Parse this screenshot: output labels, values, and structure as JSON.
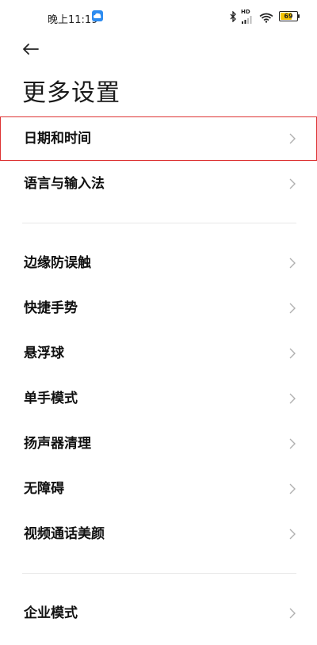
{
  "status_bar": {
    "time": "晚上11:19",
    "battery": "69",
    "battery_level": 0.69,
    "network_label": "HD",
    "icons": [
      "cloud-icon",
      "bluetooth-icon",
      "signal-icon",
      "wifi-icon",
      "battery-icon"
    ]
  },
  "header": {
    "back_icon": "arrow-left-icon",
    "title": "更多设置"
  },
  "sections": [
    {
      "items": [
        {
          "label": "日期和时间",
          "selected": true
        },
        {
          "label": "语言与输入法"
        }
      ]
    },
    {
      "items": [
        {
          "label": "边缘防误触"
        },
        {
          "label": "快捷手势"
        },
        {
          "label": "悬浮球"
        },
        {
          "label": "单手模式"
        },
        {
          "label": "扬声器清理"
        },
        {
          "label": "无障碍"
        },
        {
          "label": "视频通话美颜"
        }
      ]
    },
    {
      "items": [
        {
          "label": "企业模式"
        }
      ]
    }
  ],
  "colors": {
    "accent_outline": "#dd3333",
    "battery_fill": "#f4c400",
    "cloud": "#2d8cf0"
  }
}
